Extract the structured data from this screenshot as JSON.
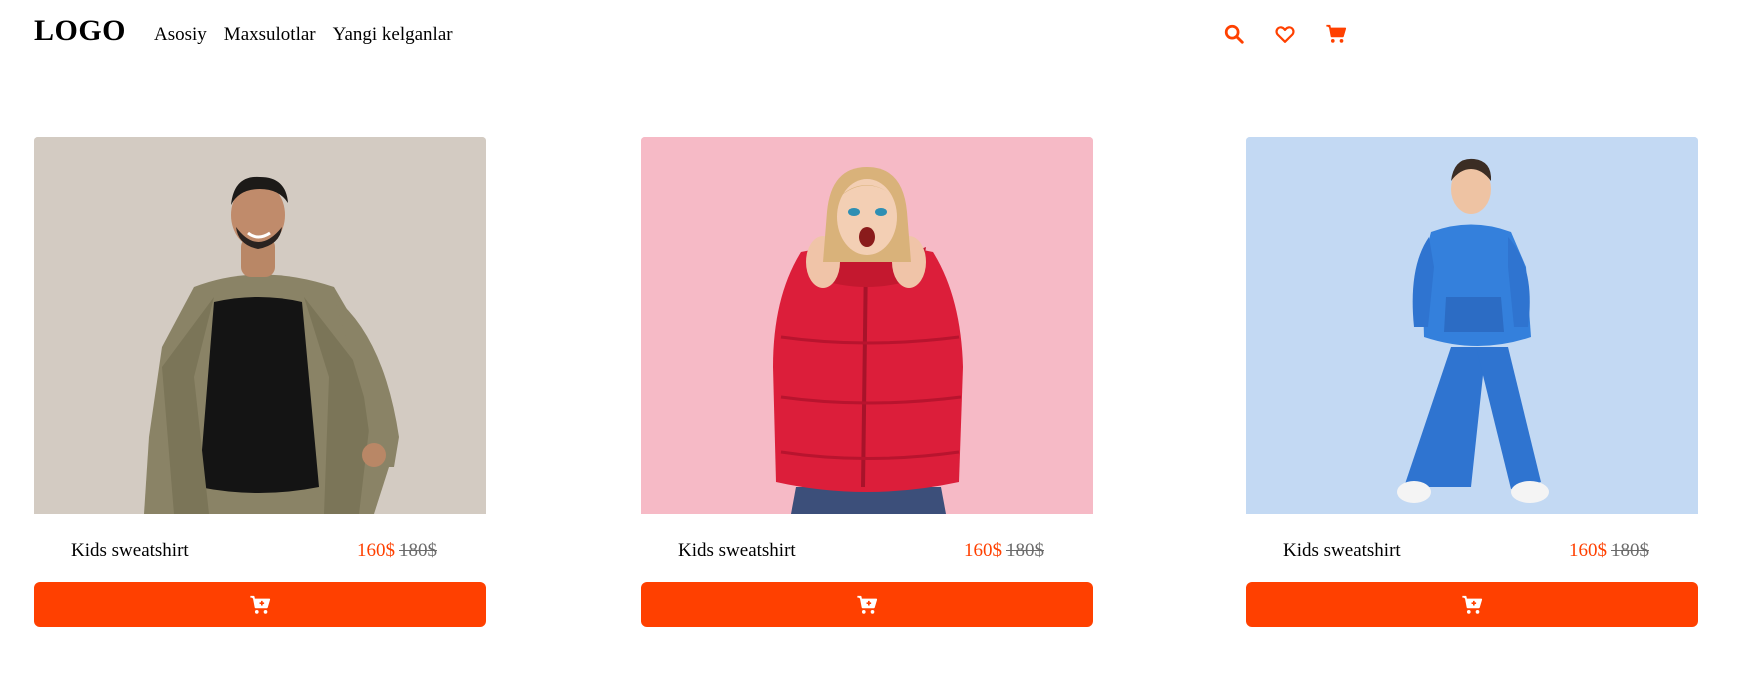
{
  "header": {
    "logo": "LOGO",
    "nav": [
      "Asosiy",
      "Maxsulotlar",
      "Yangi kelganlar"
    ],
    "icons": [
      "search-icon",
      "heart-icon",
      "cart-icon"
    ]
  },
  "colors": {
    "accent": "#ff4000",
    "old_price": "#6b6b6b"
  },
  "products": [
    {
      "name": "Kids sweatshirt",
      "price": "160$",
      "old_price": "180$",
      "image_bg": "#d3cbc2",
      "image": "man-in-olive-jacket"
    },
    {
      "name": "Kids sweatshirt",
      "price": "160$",
      "old_price": "180$",
      "image_bg": "#f6bac6",
      "image": "woman-in-red-puffer-jacket"
    },
    {
      "name": "Kids sweatshirt",
      "price": "160$",
      "old_price": "180$",
      "image_bg": "#c3d9f3",
      "image": "boy-in-blue-tracksuit"
    }
  ]
}
